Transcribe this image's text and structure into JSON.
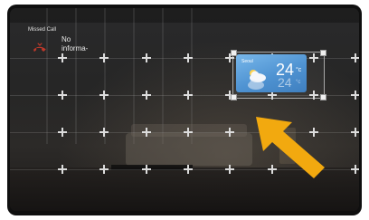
{
  "missed_call": {
    "title": "Missed Call",
    "message": "No informa-",
    "icon": "missed-call-phone-icon",
    "icon_color": "#c0392b"
  },
  "weather_widget": {
    "location": "Seoul",
    "temperature": "24",
    "unit": "°c",
    "icon": "partly-cloudy-icon",
    "card_color": "#5a9ed9"
  },
  "pointer": {
    "icon": "arrow-pointer-icon",
    "color": "#f2a90f"
  },
  "grid": {
    "icon": "plus-marker-icon"
  }
}
